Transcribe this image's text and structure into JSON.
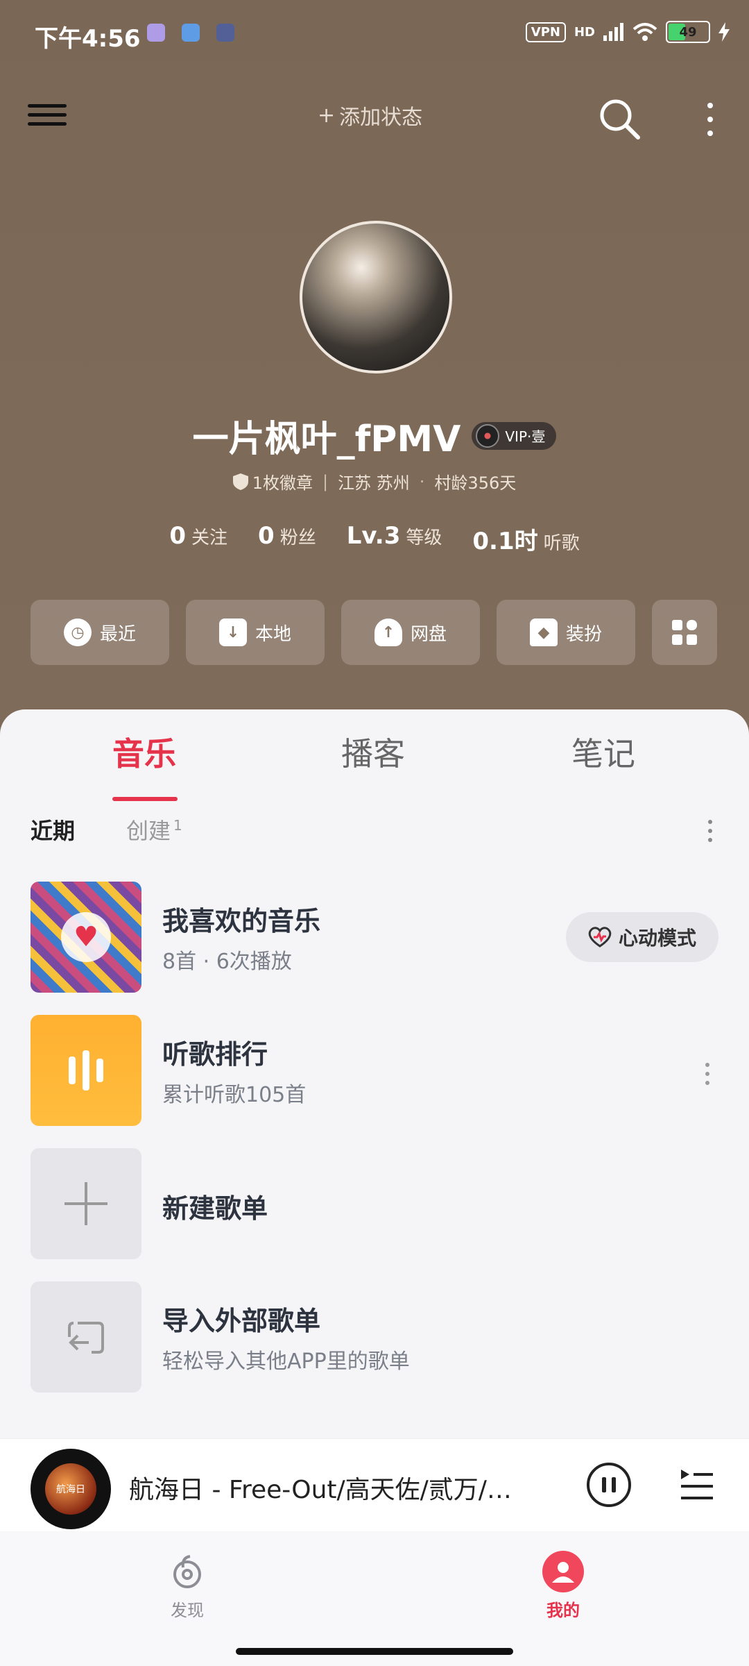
{
  "status_bar": {
    "time": "下午4:56",
    "vpn": "VPN",
    "hd": "HD",
    "battery": "49"
  },
  "header": {
    "add_status": "添加状态",
    "add_icon": "+"
  },
  "profile": {
    "nickname": "一片枫叶_fPMV",
    "vip_label": "VIP·壹",
    "badge": "1枚徽章",
    "location": "江苏 苏州",
    "village_age": "村龄356天",
    "stats": [
      {
        "value": "0",
        "label": "关注"
      },
      {
        "value": "0",
        "label": "粉丝"
      },
      {
        "value": "Lv.3",
        "label": "等级"
      },
      {
        "value": "0.1时",
        "label": "听歌"
      }
    ]
  },
  "quick_actions": [
    {
      "label": "最近",
      "icon": "clock-icon"
    },
    {
      "label": "本地",
      "icon": "download-icon"
    },
    {
      "label": "网盘",
      "icon": "cloud-upload-icon"
    },
    {
      "label": "装扮",
      "icon": "shirt-icon"
    },
    {
      "label": "",
      "icon": "grid-icon"
    }
  ],
  "tabs": [
    "音乐",
    "播客",
    "笔记"
  ],
  "subtabs": {
    "recent": "近期",
    "created": "创建",
    "created_count": "1"
  },
  "playlists": [
    {
      "title": "我喜欢的音乐",
      "subtitle": "8首 · 6次播放",
      "action": "心动模式"
    },
    {
      "title": "听歌排行",
      "subtitle": "累计听歌105首"
    },
    {
      "title": "新建歌单",
      "subtitle": ""
    },
    {
      "title": "导入外部歌单",
      "subtitle": "轻松导入其他APP里的歌单"
    }
  ],
  "player": {
    "now_playing": "航海日 - Free-Out/高天佐/贰万/…",
    "cover_text": "航海日"
  },
  "nav": {
    "discover": "发现",
    "mine": "我的"
  },
  "colors": {
    "accent": "#e5334b",
    "header_bg": "#7b6756"
  }
}
